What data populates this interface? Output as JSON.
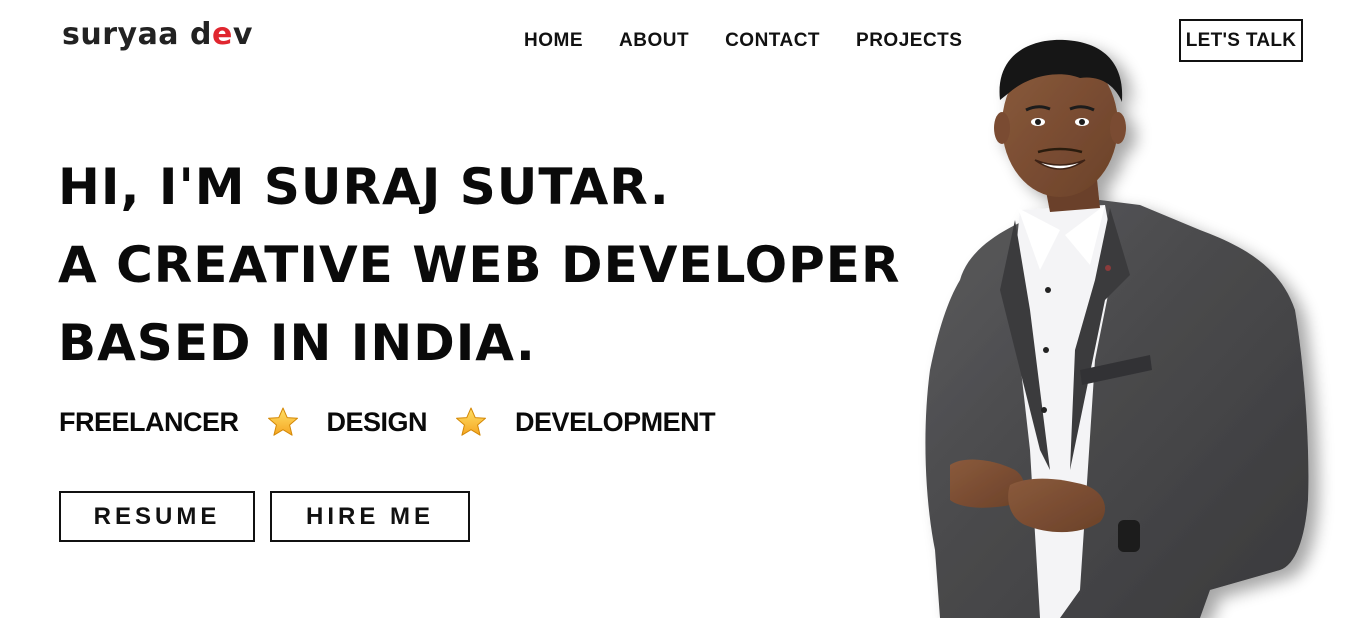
{
  "brand": {
    "logo_main": "suryaa d",
    "logo_accent": "e",
    "logo_end": "v",
    "accent_color": "#e0262f"
  },
  "nav": {
    "items": [
      "HOME",
      "ABOUT",
      "CONTACT",
      "PROJECTS"
    ]
  },
  "header": {
    "cta_label": "LET'S TALK"
  },
  "hero": {
    "lines": [
      "HI, I'M SURAJ SUTAR.",
      "A CREATIVE WEB DEVELOPER",
      "BASED IN INDIA."
    ],
    "tags": [
      "FREELANCER",
      "DESIGN",
      "DEVELOPMENT"
    ],
    "separator_icon": "star-icon",
    "buttons": {
      "resume": "RESUME",
      "hire": "HIRE ME"
    }
  },
  "portrait": {
    "icon": "person-photo"
  }
}
